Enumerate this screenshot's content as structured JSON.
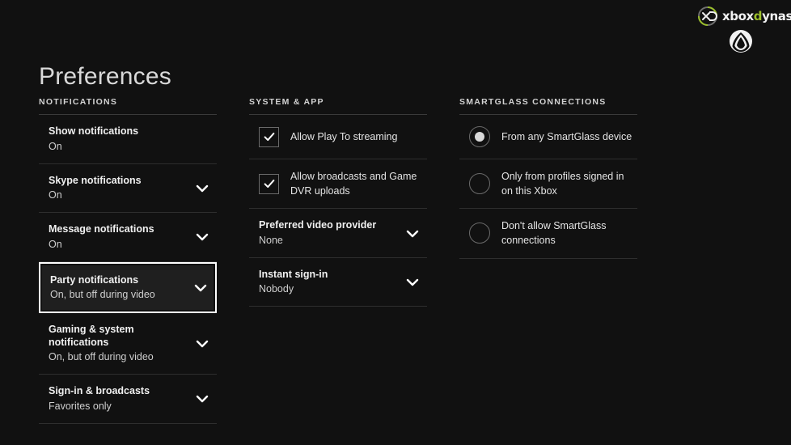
{
  "brand": {
    "name_part1": "xbox",
    "name_part2_initial": "d",
    "name_part2_rest": "ynasty",
    "mark_icon": "xd-monogram-icon",
    "sphere_icon": "xbox-sphere-icon",
    "accent_color": "#9bbf2a"
  },
  "page": {
    "title": "Preferences"
  },
  "columns": {
    "notifications": {
      "header": "NOTIFICATIONS",
      "items": [
        {
          "title": "Show notifications",
          "value": "On",
          "chevron": false,
          "focused": false
        },
        {
          "title": "Skype notifications",
          "value": "On",
          "chevron": true,
          "focused": false
        },
        {
          "title": "Message notifications",
          "value": "On",
          "chevron": true,
          "focused": false
        },
        {
          "title": "Party notifications",
          "value": "On, but off during video",
          "chevron": true,
          "focused": true
        },
        {
          "title": "Gaming & system notifications",
          "value": "On, but off during video",
          "chevron": true,
          "focused": false
        },
        {
          "title": "Sign-in & broadcasts",
          "value": "Favorites only",
          "chevron": true,
          "focused": false
        }
      ]
    },
    "system_app": {
      "header": "SYSTEM & APP",
      "checkboxes": [
        {
          "label": "Allow Play To streaming",
          "checked": true
        },
        {
          "label": "Allow broadcasts and Game DVR uploads",
          "checked": true
        }
      ],
      "items": [
        {
          "title": "Preferred video provider",
          "value": "None",
          "chevron": true
        },
        {
          "title": "Instant sign-in",
          "value": "Nobody",
          "chevron": true
        }
      ]
    },
    "smartglass": {
      "header": "SMARTGLASS CONNECTIONS",
      "options": [
        {
          "label": "From any SmartGlass device",
          "selected": true
        },
        {
          "label": "Only from profiles signed in on this Xbox",
          "selected": false
        },
        {
          "label": "Don't allow SmartGlass connections",
          "selected": false
        }
      ]
    }
  }
}
